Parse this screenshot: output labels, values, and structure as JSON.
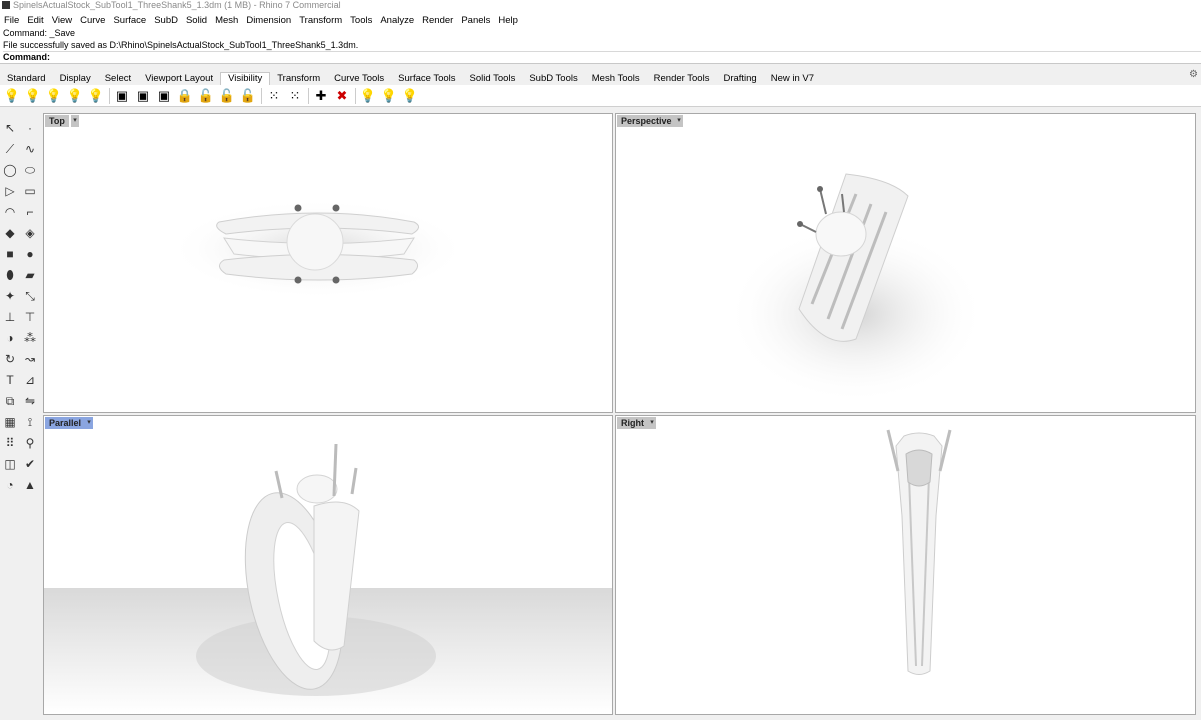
{
  "window": {
    "title": "SpinelsActualStock_SubTool1_ThreeShank5_1.3dm (1 MB) - Rhino 7 Commercial"
  },
  "menu": [
    "File",
    "Edit",
    "View",
    "Curve",
    "Surface",
    "SubD",
    "Solid",
    "Mesh",
    "Dimension",
    "Transform",
    "Tools",
    "Analyze",
    "Render",
    "Panels",
    "Help"
  ],
  "command": {
    "history": [
      "Command: _Save",
      "File successfully saved as D:\\Rhino\\SpinelsActualStock_SubTool1_ThreeShank5_1.3dm."
    ],
    "prompt": "Command:"
  },
  "tabs": [
    "Standard",
    "Display",
    "Select",
    "Viewport Layout",
    "Visibility",
    "Transform",
    "Curve Tools",
    "Surface Tools",
    "Solid Tools",
    "SubD Tools",
    "Mesh Tools",
    "Render Tools",
    "Drafting",
    "New in V7"
  ],
  "active_tab": "Visibility",
  "toolbar_icons": [
    "show-objects-icon",
    "hide-objects-icon",
    "show-selected-icon",
    "hide-swap-icon",
    "show-all-icon",
    "lock-objects-icon",
    "unlock-objects-icon",
    "unlock-selected-icon",
    "lock-icon",
    "unlock-icon",
    "lock-swap-icon",
    "lock-toggle-icon",
    "hide-points-icon",
    "show-points-icon",
    "hide-camera-icon",
    "delete-hidden-icon",
    "bulb-1-icon",
    "bulb-2-icon",
    "bulb-3-icon"
  ],
  "viewports": {
    "top": {
      "label": "Top"
    },
    "perspective": {
      "label": "Perspective"
    },
    "parallel": {
      "label": "Parallel",
      "active": true
    },
    "right": {
      "label": "Right"
    }
  },
  "colors": {
    "active_viewport_label": "#8aa5e0",
    "inactive_viewport_label": "#c4c4c4",
    "viewport_bg": "#ffffff"
  }
}
